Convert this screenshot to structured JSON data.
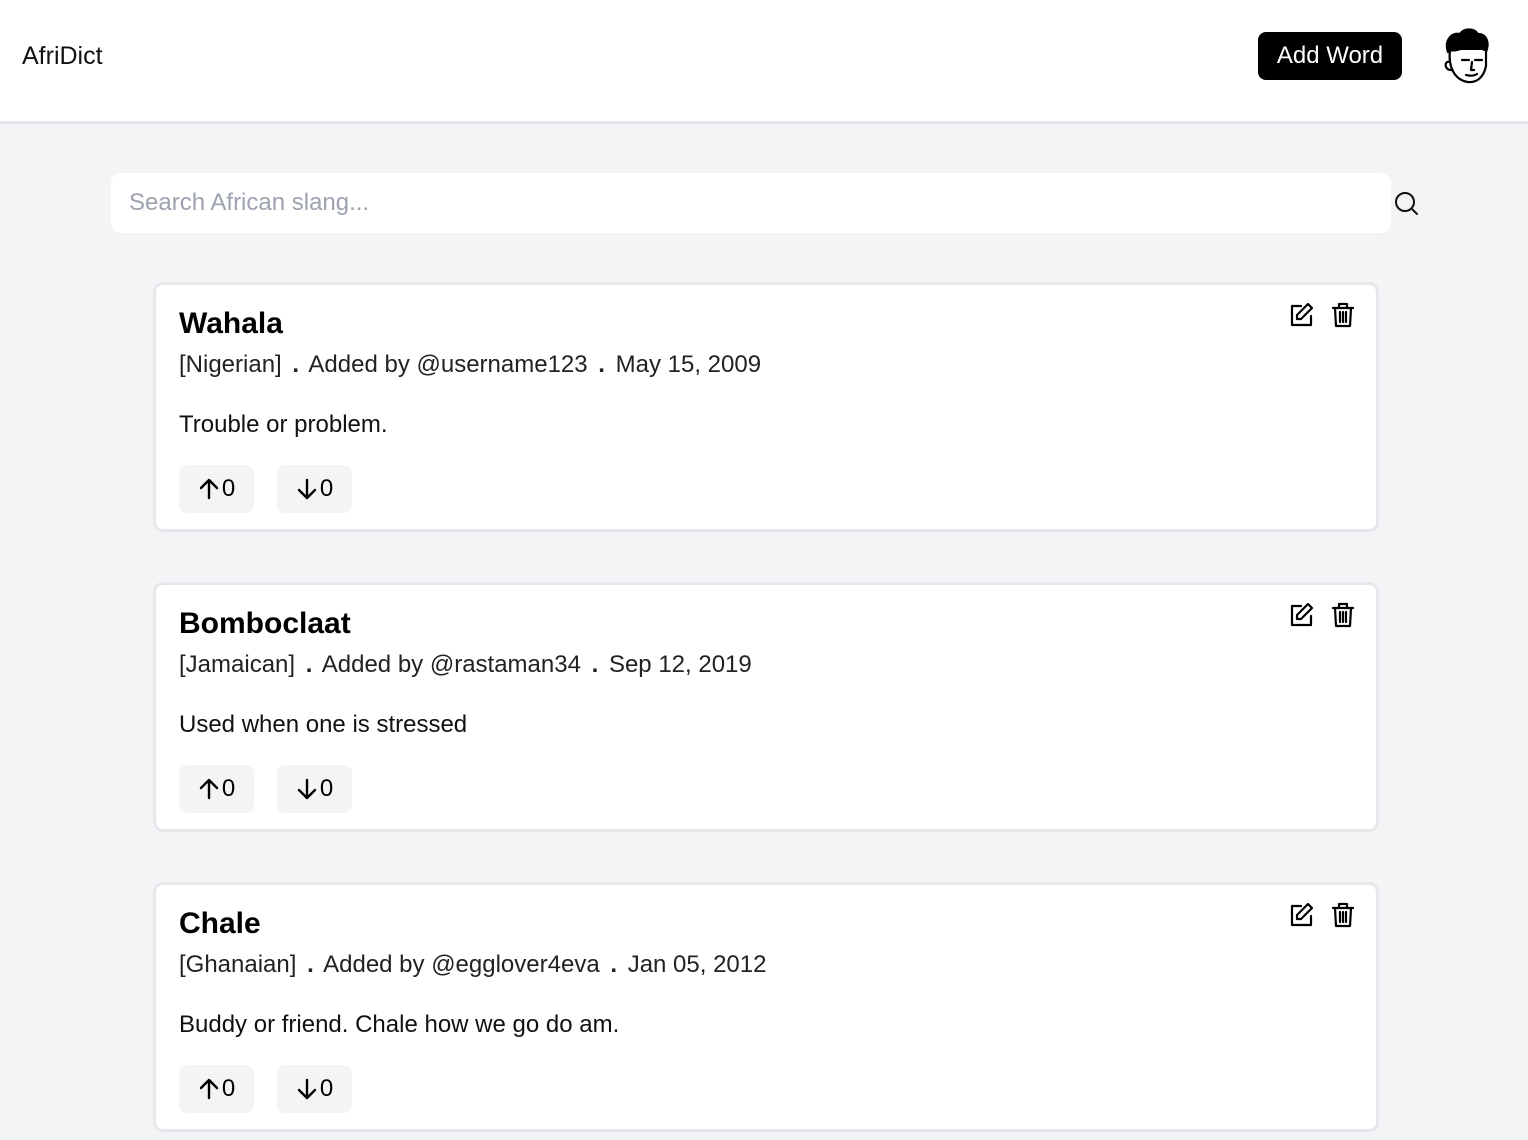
{
  "header": {
    "brand": "AfriDict",
    "add_word_label": "Add Word"
  },
  "search": {
    "placeholder": "Search African slang...",
    "value": ""
  },
  "entries": [
    {
      "word": "Wahala",
      "language": "[Nigerian]",
      "added_by": "Added by @username123",
      "date": "May 15, 2009",
      "definition": "Trouble or problem.",
      "upvotes": "0",
      "downvotes": "0"
    },
    {
      "word": "Bomboclaat",
      "language": "[Jamaican]",
      "added_by": "Added by @rastaman34",
      "date": "Sep 12, 2019",
      "definition": "Used when one is stressed",
      "upvotes": "0",
      "downvotes": "0"
    },
    {
      "word": "Chale",
      "language": "[Ghanaian]",
      "added_by": "Added by @egglover4eva",
      "date": "Jan 05, 2012",
      "definition": "Buddy or friend. Chale how we go do am.",
      "upvotes": "0",
      "downvotes": "0"
    }
  ],
  "separator": ".",
  "icons": {
    "avatar": "cartoon-face-avatar",
    "search": "search-icon",
    "edit": "edit-icon",
    "delete": "trash-icon",
    "upvote": "arrow-up-icon",
    "downvote": "arrow-down-icon"
  }
}
